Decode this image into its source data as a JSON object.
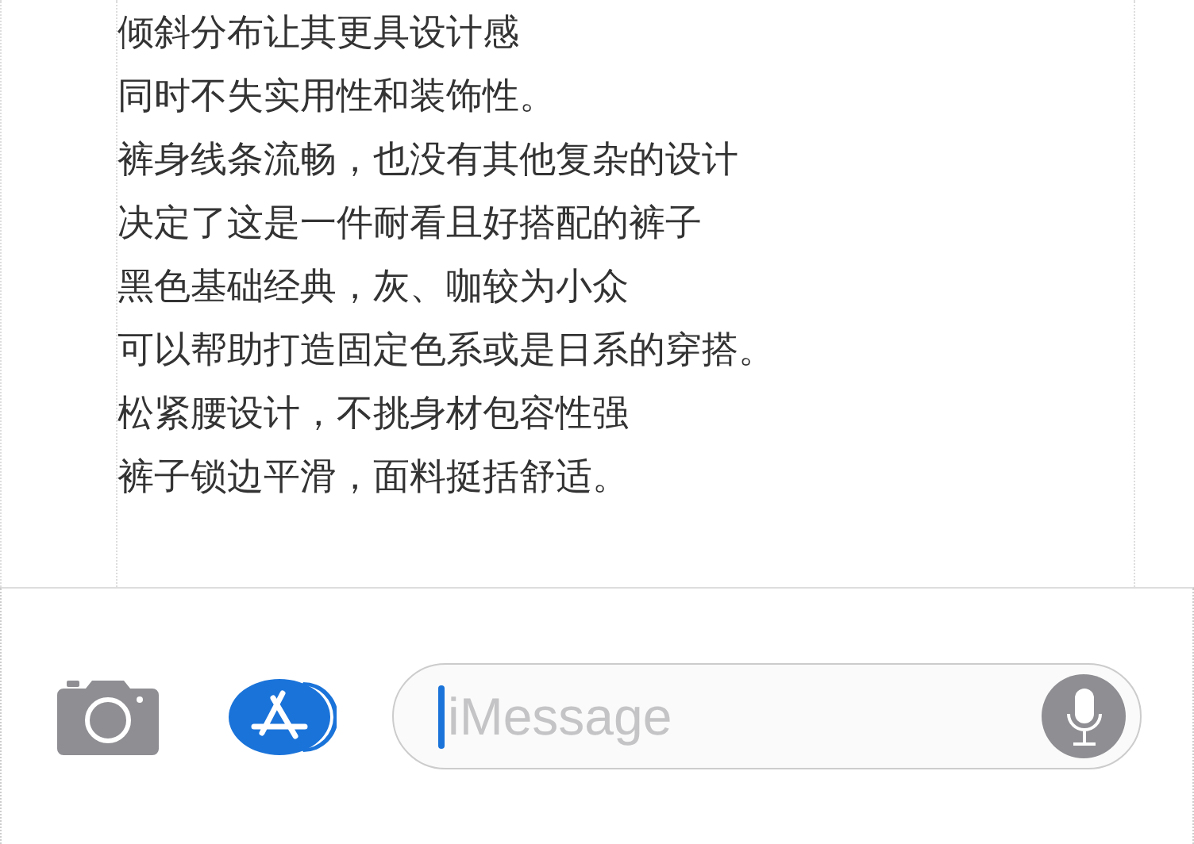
{
  "description_lines": [
    "倾斜分布让其更具设计感",
    "同时不失实用性和装饰性。",
    "裤身线条流畅，也没有其他复杂的设计",
    "决定了这是一件耐看且好搭配的裤子",
    "黑色基础经典，灰、咖较为小众",
    "可以帮助打造固定色系或是日系的穿搭。",
    "松紧腰设计，不挑身材包容性强",
    "裤子锁边平滑，面料挺括舒适。"
  ],
  "message_bar": {
    "placeholder": "iMessage"
  }
}
